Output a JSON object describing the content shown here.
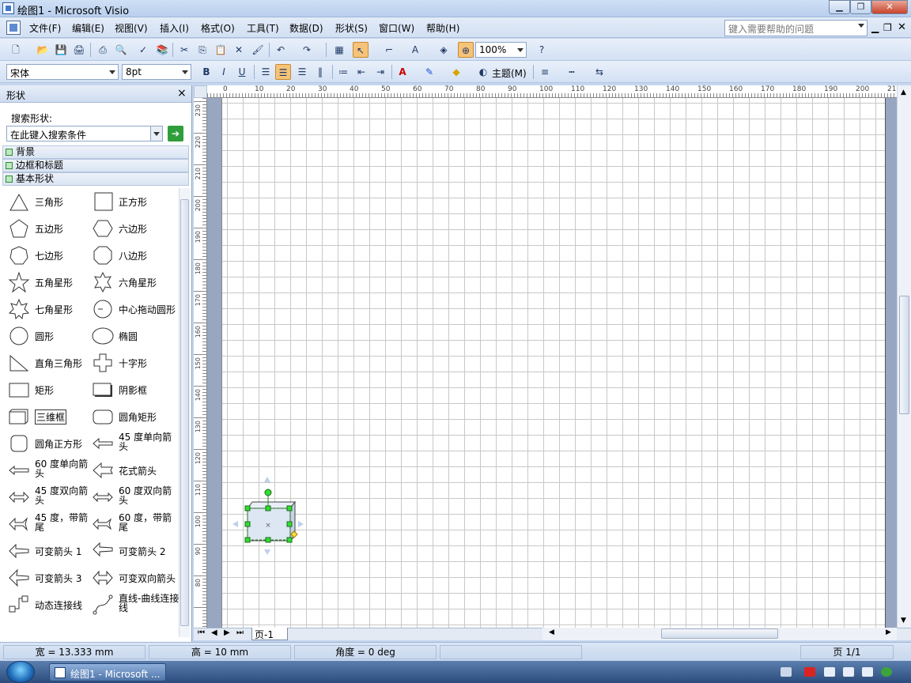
{
  "window": {
    "title": "绘图1 - Microsoft Visio"
  },
  "menu": [
    "文件(F)",
    "编辑(E)",
    "视图(V)",
    "插入(I)",
    "格式(O)",
    "工具(T)",
    "数据(D)",
    "形状(S)",
    "窗口(W)",
    "帮助(H)"
  ],
  "help_placeholder": "键入需要帮助的问题",
  "toolbar": {
    "zoom": "100%",
    "theme_label": "主题(M)",
    "font": "宋体",
    "font_size": "8pt",
    "bold": "B",
    "italic": "I",
    "underline": "U"
  },
  "shapes_pane": {
    "title": "形状",
    "search_label": "搜索形状:",
    "search_placeholder": "在此键入搜索条件",
    "stencils": [
      "背景",
      "边框和标题",
      "基本形状"
    ],
    "items": [
      {
        "label": "三角形",
        "icon": "triangle-icon"
      },
      {
        "label": "正方形",
        "icon": "square-icon"
      },
      {
        "label": "五边形",
        "icon": "pentagon-icon"
      },
      {
        "label": "六边形",
        "icon": "hexagon-icon"
      },
      {
        "label": "七边形",
        "icon": "heptagon-icon"
      },
      {
        "label": "八边形",
        "icon": "octagon-icon"
      },
      {
        "label": "五角星形",
        "icon": "star5-icon"
      },
      {
        "label": "六角星形",
        "icon": "star6-icon"
      },
      {
        "label": "七角星形",
        "icon": "star7-icon"
      },
      {
        "label": "中心拖动圆形",
        "icon": "center-circle-icon"
      },
      {
        "label": "圆形",
        "icon": "circle-icon"
      },
      {
        "label": "椭圆",
        "icon": "ellipse-icon"
      },
      {
        "label": "直角三角形",
        "icon": "right-triangle-icon"
      },
      {
        "label": "十字形",
        "icon": "cross-icon"
      },
      {
        "label": "矩形",
        "icon": "rectangle-icon"
      },
      {
        "label": "阴影框",
        "icon": "shadow-box-icon"
      },
      {
        "label": "三维框",
        "icon": "3d-box-icon"
      },
      {
        "label": "圆角矩形",
        "icon": "rounded-rect-icon"
      },
      {
        "label": "圆角正方形",
        "icon": "rounded-square-icon"
      },
      {
        "label": "45 度单向箭头",
        "icon": "arrow-45-icon"
      },
      {
        "label": "60 度单向箭头",
        "icon": "arrow-60-icon"
      },
      {
        "label": "花式箭头",
        "icon": "fancy-arrow-icon"
      },
      {
        "label": "45 度双向箭头",
        "icon": "double-arrow-45-icon"
      },
      {
        "label": "60 度双向箭头",
        "icon": "double-arrow-60-icon"
      },
      {
        "label": "45 度，带箭尾",
        "icon": "tail-arrow-45-icon"
      },
      {
        "label": "60 度，带箭尾",
        "icon": "tail-arrow-60-icon"
      },
      {
        "label": "可变箭头 1",
        "icon": "flex-arrow1-icon"
      },
      {
        "label": "可变箭头 2",
        "icon": "flex-arrow2-icon"
      },
      {
        "label": "可变箭头 3",
        "icon": "flex-arrow3-icon"
      },
      {
        "label": "可变双向箭头",
        "icon": "flex-double-arrow-icon"
      },
      {
        "label": "动态连接线",
        "icon": "dynamic-connector-icon"
      },
      {
        "label": "直线-曲线连接线",
        "icon": "line-curve-connector-icon"
      }
    ]
  },
  "rulers": {
    "h": [
      "0",
      "10",
      "20",
      "30",
      "40",
      "50",
      "60",
      "70",
      "80",
      "90",
      "100",
      "110",
      "120",
      "130",
      "140",
      "150",
      "160",
      "170",
      "180",
      "190",
      "200",
      "21"
    ],
    "v": [
      "230",
      "220",
      "210",
      "200",
      "190",
      "180",
      "170",
      "160",
      "150",
      "140",
      "130",
      "120",
      "110",
      "100",
      "90",
      "80"
    ]
  },
  "page_tab": "页-1",
  "status": {
    "width": "宽 = 13.333 mm",
    "height": "高 = 10 mm",
    "angle": "角度 = 0 deg",
    "page": "页 1/1"
  },
  "taskbar": {
    "item": "绘图1 - Microsoft ..."
  },
  "colors": {
    "selection_handle": "#22cc22",
    "canvas_bg": "#98a6c1"
  }
}
